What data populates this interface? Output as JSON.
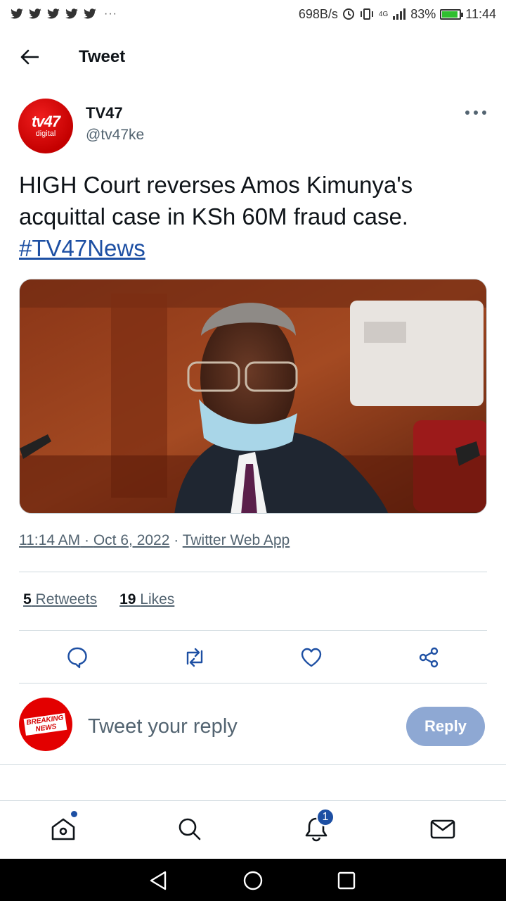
{
  "status_bar": {
    "network_speed": "698B/s",
    "signal_label": "4G",
    "battery": "83%",
    "time": "11:44",
    "notification_icons": [
      "twitter-icon",
      "twitter-icon",
      "twitter-icon",
      "twitter-icon",
      "twitter-icon"
    ],
    "overflow": "···"
  },
  "header": {
    "title": "Tweet"
  },
  "author": {
    "name": "TV47",
    "handle": "@tv47ke",
    "avatar_text": "tv47",
    "avatar_subtext": "digital"
  },
  "tweet": {
    "text": "HIGH Court reverses Amos Kimunya's acquittal case in KSh 60M fraud case.",
    "hashtag": "#TV47News",
    "time": "11:14 AM",
    "date": "Oct 6, 2022",
    "source": "Twitter Web App"
  },
  "stats": {
    "retweets_count": "5",
    "retweets_label": "Retweets",
    "likes_count": "19",
    "likes_label": "Likes"
  },
  "reply": {
    "placeholder": "Tweet your reply",
    "button_label": "Reply",
    "avatar_line1": "BREAKING",
    "avatar_line2": "NEWS"
  },
  "bottom_nav": {
    "notifications_badge": "1"
  },
  "colors": {
    "accent": "#1d4fa3",
    "reply_button": "#8ea8d3",
    "avatar_red": "#d40000"
  }
}
